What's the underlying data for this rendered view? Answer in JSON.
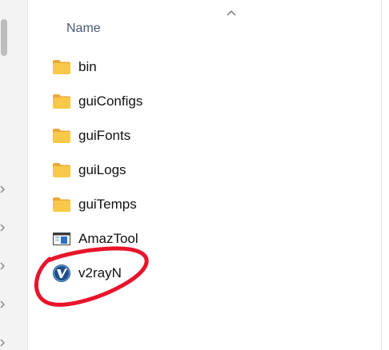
{
  "column_header": {
    "name_label": "Name"
  },
  "files": [
    {
      "name": "bin",
      "type": "folder",
      "icon": "folder-icon"
    },
    {
      "name": "guiConfigs",
      "type": "folder",
      "icon": "folder-icon"
    },
    {
      "name": "guiFonts",
      "type": "folder",
      "icon": "folder-icon"
    },
    {
      "name": "guiLogs",
      "type": "folder",
      "icon": "folder-icon"
    },
    {
      "name": "guiTemps",
      "type": "folder",
      "icon": "folder-icon"
    },
    {
      "name": "AmazTool",
      "type": "application",
      "icon": "app-window-icon"
    },
    {
      "name": "v2rayN",
      "type": "application",
      "icon": "v2rayn-app-icon"
    }
  ],
  "colors": {
    "folder": "#f8c948",
    "folder_dark": "#e8a93a",
    "annotation": "#e8142b",
    "header_text": "#4a5a78"
  }
}
